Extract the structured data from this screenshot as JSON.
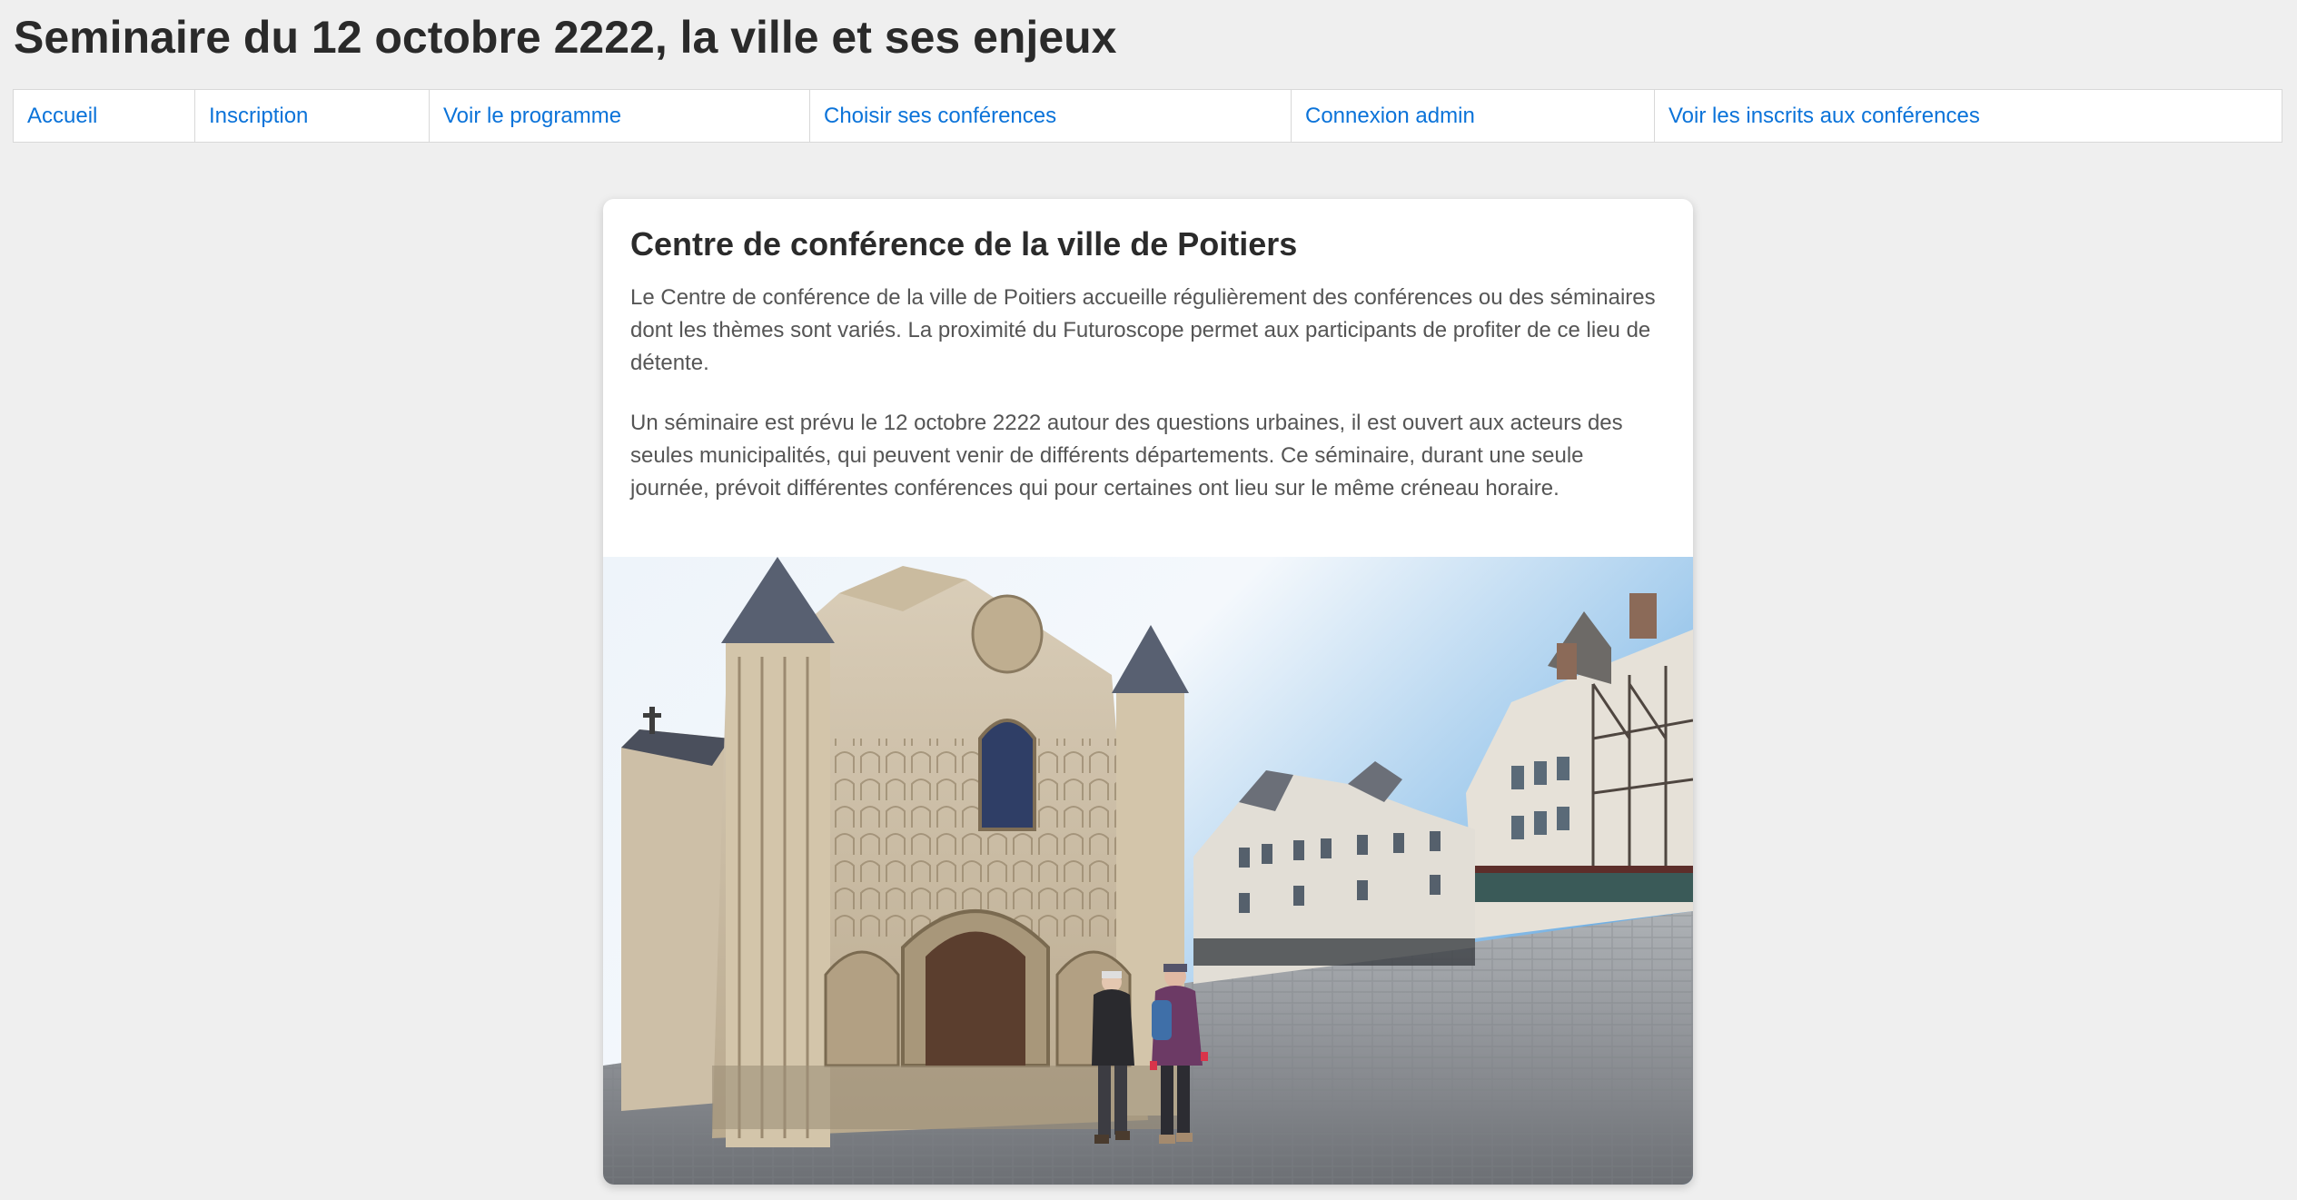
{
  "header": {
    "title": "Seminaire du 12 octobre 2222, la ville et ses enjeux"
  },
  "nav": {
    "items": [
      {
        "label": "Accueil"
      },
      {
        "label": "Inscription"
      },
      {
        "label": "Voir le programme"
      },
      {
        "label": "Choisir ses conférences"
      },
      {
        "label": "Connexion admin"
      },
      {
        "label": "Voir les inscrits aux conférences"
      }
    ]
  },
  "card": {
    "title": "Centre de conférence de la ville de Poitiers",
    "paragraphs": [
      "Le Centre de conférence de la ville de Poitiers accueille régulièrement des conférences ou des séminaires dont les thèmes sont variés. La proximité du Futuroscope permet aux participants de profiter de ce lieu de détente.",
      "Un séminaire est prévu le 12 octobre 2222 autour des questions urbaines, il est ouvert aux acteurs des seules municipalités, qui peuvent venir de différents départements. Ce séminaire, durant une seule journée, prévoit différentes conférences qui pour certaines ont lieu sur le même créneau horaire."
    ]
  },
  "colors": {
    "background": "#efefef",
    "link": "#0b73d9",
    "card": "#ffffff"
  }
}
